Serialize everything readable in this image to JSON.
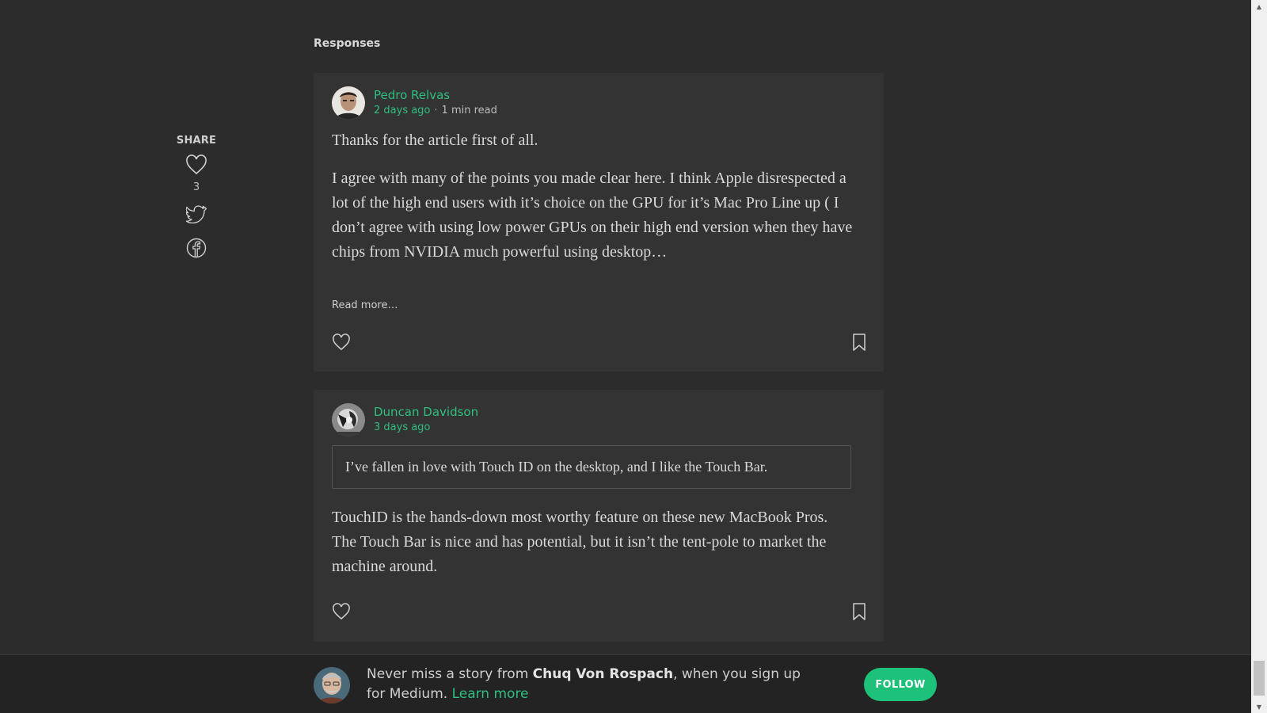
{
  "responses_heading": "Responses",
  "share": {
    "label": "SHARE",
    "like_count": "3",
    "icons": [
      "heart-icon",
      "twitter-icon",
      "facebook-icon"
    ]
  },
  "responses": [
    {
      "author": "Pedro Relvas",
      "time": "2 days ago",
      "separator": "·",
      "read_time": "1 min read",
      "intro": "Thanks for the article first of all.",
      "body": "I agree with many of the points you made clear here. I think Apple disrespected a lot of the high end users with it’s choice on the GPU for it’s Mac Pro Line up ( I don’t agree with using low power GPUs on their high end version when they have chips from NVIDIA much powerful using desktop…",
      "read_more": "Read more…"
    },
    {
      "author": "Duncan Davidson",
      "time": "3 days ago",
      "quote": "I’ve fallen in love with Touch ID on the desktop, and I like the Touch Bar.",
      "body": "TouchID is the hands-down most worthy feature on these new MacBook Pros. The Touch Bar is nice and has potential, but it isn’t the tent-pole to market the machine around."
    }
  ],
  "footer": {
    "prefix": "Never miss a story from ",
    "author": "Chuq Von Rospach",
    "suffix": ", when you sign up for Medium. ",
    "link": "Learn more",
    "follow_label": "FOLLOW"
  },
  "colors": {
    "background": "#2c2c2c",
    "card": "#333333",
    "accent": "#1ec17a",
    "link": "#2fbf7f",
    "footer_bg": "#232323"
  }
}
